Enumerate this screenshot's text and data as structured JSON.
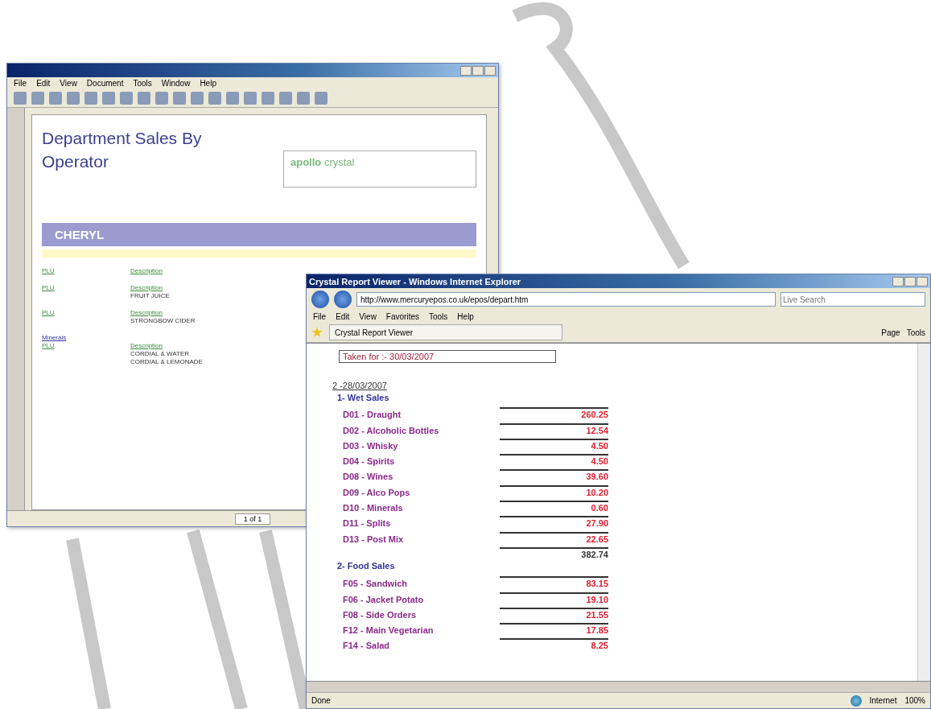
{
  "pdf_window": {
    "menu": [
      "File",
      "Edit",
      "View",
      "Document",
      "Tools",
      "Window",
      "Help"
    ],
    "report": {
      "title": "Department Sales By Operator",
      "logo": "**apollo** crystal",
      "operator": "CHERYL",
      "sections": [
        {
          "columns": [
            "PLU",
            "Description"
          ]
        },
        {
          "columns": [
            "PLU",
            "Description"
          ],
          "items": [
            "FRUIT JUICE"
          ]
        },
        {
          "columns": [
            "PLU",
            "Description"
          ],
          "items": [
            "STRONGBOW CIDER"
          ]
        },
        {
          "heading": "Minerals",
          "columns": [
            "PLU",
            "Description"
          ],
          "items": [
            "CORDIAL & WATER",
            "CORDIAL & LEMONADE"
          ]
        }
      ]
    },
    "page": "1 of 1"
  },
  "browser_window": {
    "title": "Crystal Report Viewer - Windows Internet Explorer",
    "url": "http://www.mercuryepos.co.uk/epos/depart.htm",
    "search": {
      "placeholder": "Live Search"
    },
    "menu": [
      "File",
      "Edit",
      "View",
      "Favorites",
      "Tools",
      "Help"
    ],
    "tab": "Crystal Report Viewer",
    "commands": [
      "Page",
      "Tools"
    ],
    "report": {
      "taken_for": "Taken for :-  30/03/2007",
      "date": "2 -28/03/2007",
      "groups": [
        {
          "title": "1- Wet Sales",
          "total": "382.74",
          "items": [
            {
              "label": "D01 - Draught",
              "value": "260.25"
            },
            {
              "label": "D02 - Alcoholic Bottles",
              "value": "12.54"
            },
            {
              "label": "D03 - Whisky",
              "value": "4.50"
            },
            {
              "label": "D04 - Spirits",
              "value": "4.50"
            },
            {
              "label": "D08 - Wines",
              "value": "39.60"
            },
            {
              "label": "D09 - Alco Pops",
              "value": "10.20"
            },
            {
              "label": "D10 - Minerals",
              "value": "0.60"
            },
            {
              "label": "D11 - Splits",
              "value": "27.90"
            },
            {
              "label": "D13 - Post Mix",
              "value": "22.65"
            }
          ]
        },
        {
          "title": "2- Food Sales",
          "items": [
            {
              "label": "F05 - Sandwich",
              "value": "83.15"
            },
            {
              "label": "F06 - Jacket Potato",
              "value": "19.10"
            },
            {
              "label": "F08 - Side Orders",
              "value": "21.55"
            },
            {
              "label": "F12 - Main Vegetarian",
              "value": "17.85"
            },
            {
              "label": "F14 - Salad",
              "value": "8.25"
            }
          ]
        }
      ]
    },
    "status": "Done",
    "zone": "Internet",
    "zoom": "100%"
  }
}
